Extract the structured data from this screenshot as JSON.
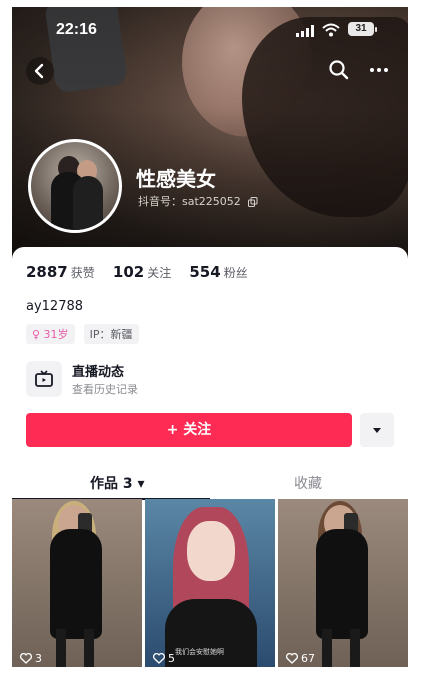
{
  "status_bar": {
    "time": "22:16",
    "battery": "31",
    "icons": [
      "signal-icon",
      "wifi-icon",
      "battery-icon"
    ]
  },
  "nav": {
    "icons": [
      "back-arrow-icon",
      "search-icon",
      "more-dots-icon"
    ]
  },
  "profile": {
    "name": "性感美女",
    "douyin_id": "抖音号：sat225052",
    "stats": [
      {
        "value": "2887",
        "label": "获赞"
      },
      {
        "value": "102",
        "label": "关注"
      },
      {
        "value": "554",
        "label": "粉丝"
      }
    ],
    "bio": "ay12788",
    "tags": [
      "♀ 31岁",
      "IP：新疆"
    ]
  },
  "live": {
    "title": "直播动态",
    "subtitle": "查看历史记录"
  },
  "actions": {
    "follow_label": "+ 关注",
    "more_icon": "triangle-down-icon"
  },
  "tabs": {
    "works_label": "作品 3 ▾",
    "favorites_label": "收藏"
  },
  "videos": [
    {
      "likes": "3"
    },
    {
      "likes": "5",
      "caption": "我们会安慰她啊"
    },
    {
      "likes": "67"
    }
  ],
  "colors": {
    "accent": "#fe2c55",
    "text": "#161823",
    "muted": "#8a8b91"
  }
}
